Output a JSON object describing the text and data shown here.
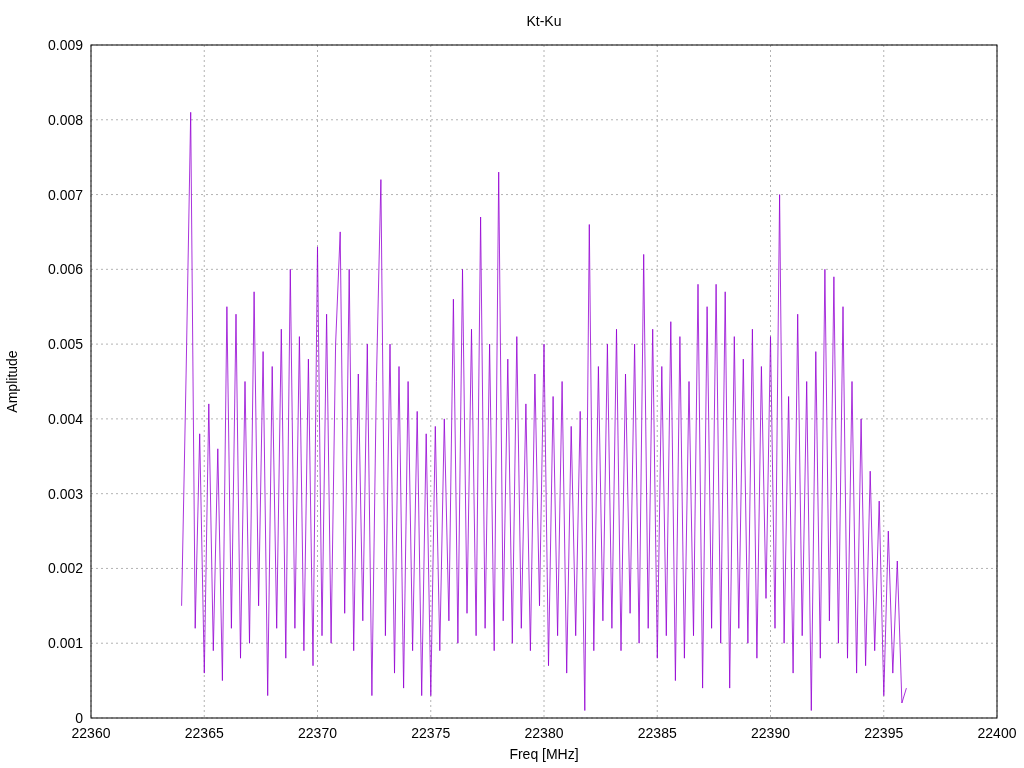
{
  "chart_data": {
    "type": "line",
    "title": "Kt-Ku",
    "xlabel": "Freq [MHz]",
    "ylabel": "Amplitude",
    "xlim": [
      22360,
      22400
    ],
    "ylim": [
      0,
      0.009
    ],
    "grid": true,
    "xticks": [
      {
        "value": 22360,
        "label": "22360"
      },
      {
        "value": 22365,
        "label": "22365"
      },
      {
        "value": 22370,
        "label": "22370"
      },
      {
        "value": 22375,
        "label": "22375"
      },
      {
        "value": 22380,
        "label": "22380"
      },
      {
        "value": 22385,
        "label": "22385"
      },
      {
        "value": 22390,
        "label": "22390"
      },
      {
        "value": 22395,
        "label": "22395"
      },
      {
        "value": 22400,
        "label": "22400"
      }
    ],
    "yticks": [
      {
        "value": 0,
        "label": "0"
      },
      {
        "value": 0.001,
        "label": "0.001"
      },
      {
        "value": 0.002,
        "label": "0.002"
      },
      {
        "value": 0.003,
        "label": "0.003"
      },
      {
        "value": 0.004,
        "label": "0.004"
      },
      {
        "value": 0.005,
        "label": "0.005"
      },
      {
        "value": 0.006,
        "label": "0.006"
      },
      {
        "value": 0.007,
        "label": "0.007"
      },
      {
        "value": 0.008,
        "label": "0.008"
      },
      {
        "value": 0.009,
        "label": "0.009"
      }
    ],
    "x": [
      22364.0,
      22364.2,
      22364.4,
      22364.6,
      22364.8,
      22365.0,
      22365.2,
      22365.4,
      22365.6,
      22365.8,
      22366.0,
      22366.2,
      22366.4,
      22366.6,
      22366.8,
      22367.0,
      22367.2,
      22367.4,
      22367.6,
      22367.8,
      22368.0,
      22368.2,
      22368.4,
      22368.6,
      22368.8,
      22369.0,
      22369.2,
      22369.4,
      22369.6,
      22369.8,
      22370.0,
      22370.2,
      22370.4,
      22370.6,
      22370.8,
      22371.0,
      22371.2,
      22371.4,
      22371.6,
      22371.8,
      22372.0,
      22372.2,
      22372.4,
      22372.6,
      22372.8,
      22373.0,
      22373.2,
      22373.4,
      22373.6,
      22373.8,
      22374.0,
      22374.2,
      22374.4,
      22374.6,
      22374.8,
      22375.0,
      22375.2,
      22375.4,
      22375.6,
      22375.8,
      22376.0,
      22376.2,
      22376.4,
      22376.6,
      22376.8,
      22377.0,
      22377.2,
      22377.4,
      22377.6,
      22377.8,
      22378.0,
      22378.2,
      22378.4,
      22378.6,
      22378.8,
      22379.0,
      22379.2,
      22379.4,
      22379.6,
      22379.8,
      22380.0,
      22380.2,
      22380.4,
      22380.6,
      22380.8,
      22381.0,
      22381.2,
      22381.4,
      22381.6,
      22381.8,
      22382.0,
      22382.2,
      22382.4,
      22382.6,
      22382.8,
      22383.0,
      22383.2,
      22383.4,
      22383.6,
      22383.8,
      22384.0,
      22384.2,
      22384.4,
      22384.6,
      22384.8,
      22385.0,
      22385.2,
      22385.4,
      22385.6,
      22385.8,
      22386.0,
      22386.2,
      22386.4,
      22386.6,
      22386.8,
      22387.0,
      22387.2,
      22387.4,
      22387.6,
      22387.8,
      22388.0,
      22388.2,
      22388.4,
      22388.6,
      22388.8,
      22389.0,
      22389.2,
      22389.4,
      22389.6,
      22389.8,
      22390.0,
      22390.2,
      22390.4,
      22390.6,
      22390.8,
      22391.0,
      22391.2,
      22391.4,
      22391.6,
      22391.8,
      22392.0,
      22392.2,
      22392.4,
      22392.6,
      22392.8,
      22393.0,
      22393.2,
      22393.4,
      22393.6,
      22393.8,
      22394.0,
      22394.2,
      22394.4,
      22394.6,
      22394.8,
      22395.0,
      22395.2,
      22395.4,
      22395.6,
      22395.8,
      22396.0
    ],
    "series": [
      {
        "color": "#9400d3",
        "values": [
          0.0015,
          0.0046,
          0.0081,
          0.0012,
          0.0038,
          0.0006,
          0.0042,
          0.0009,
          0.0036,
          0.0005,
          0.0055,
          0.0012,
          0.0054,
          0.0008,
          0.0045,
          0.001,
          0.0057,
          0.0015,
          0.0049,
          0.0003,
          0.0047,
          0.0012,
          0.0052,
          0.0008,
          0.006,
          0.0012,
          0.0051,
          0.0009,
          0.0048,
          0.0007,
          0.0063,
          0.0011,
          0.0054,
          0.001,
          0.005,
          0.0065,
          0.0014,
          0.006,
          0.0009,
          0.0046,
          0.0013,
          0.005,
          0.0003,
          0.0045,
          0.0072,
          0.0011,
          0.005,
          0.0006,
          0.0047,
          0.0004,
          0.0045,
          0.0009,
          0.0041,
          0.0003,
          0.0038,
          0.0003,
          0.0039,
          0.0009,
          0.004,
          0.0013,
          0.0056,
          0.001,
          0.006,
          0.0014,
          0.0052,
          0.0011,
          0.0067,
          0.0012,
          0.005,
          0.0009,
          0.0073,
          0.0013,
          0.0048,
          0.001,
          0.0051,
          0.0012,
          0.0042,
          0.0009,
          0.0046,
          0.0015,
          0.005,
          0.0007,
          0.0043,
          0.0011,
          0.0045,
          0.0006,
          0.0039,
          0.0011,
          0.0041,
          0.0001,
          0.0066,
          0.0009,
          0.0047,
          0.0013,
          0.005,
          0.0012,
          0.0052,
          0.0009,
          0.0046,
          0.0014,
          0.005,
          0.001,
          0.0062,
          0.0012,
          0.0052,
          0.0008,
          0.0047,
          0.0011,
          0.0053,
          0.0005,
          0.0051,
          0.0008,
          0.0045,
          0.0011,
          0.0058,
          0.0004,
          0.0055,
          0.0012,
          0.0058,
          0.001,
          0.0057,
          0.0004,
          0.0051,
          0.0012,
          0.0048,
          0.001,
          0.0052,
          0.0008,
          0.0047,
          0.0016,
          0.0051,
          0.0012,
          0.007,
          0.001,
          0.0043,
          0.0006,
          0.0054,
          0.0011,
          0.0045,
          0.0001,
          0.0049,
          0.0008,
          0.006,
          0.0013,
          0.0059,
          0.001,
          0.0055,
          0.0008,
          0.0045,
          0.0006,
          0.004,
          0.0007,
          0.0033,
          0.0009,
          0.0029,
          0.0003,
          0.0025,
          0.0006,
          0.0021,
          0.0002,
          0.0004
        ]
      }
    ]
  }
}
